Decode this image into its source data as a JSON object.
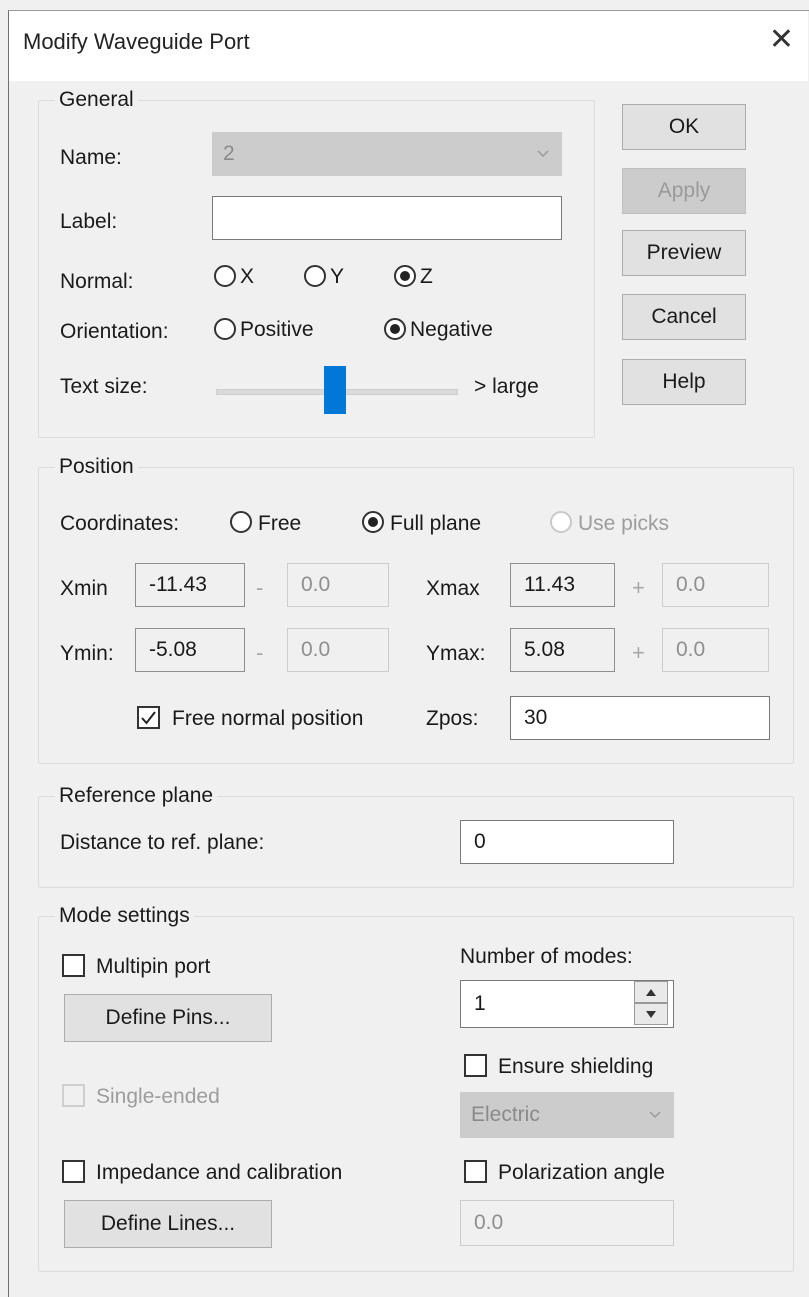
{
  "window": {
    "title": "Modify Waveguide Port",
    "close_glyph": "✕"
  },
  "general": {
    "legend": "General",
    "name_label": "Name:",
    "name_value": "2",
    "label_label": "Label:",
    "label_value": "",
    "normal_label": "Normal:",
    "normal_options": [
      "X",
      "Y",
      "Z"
    ],
    "normal_selected": "Z",
    "orientation_label": "Orientation:",
    "orientation_options": [
      "Positive",
      "Negative"
    ],
    "orientation_selected": "Negative",
    "text_size_label": "Text size:",
    "text_size_level": 0.5,
    "text_size_hint": "> large"
  },
  "buttons": {
    "ok": "OK",
    "apply": "Apply",
    "preview": "Preview",
    "cancel": "Cancel",
    "help": "Help"
  },
  "position": {
    "legend": "Position",
    "coordinates_label": "Coordinates:",
    "coordinates_options": [
      "Free",
      "Full plane",
      "Use picks"
    ],
    "coordinates_selected": "Full plane",
    "xmin_label": "Xmin",
    "xmin_value": "-11.43",
    "xmin_minus": "-",
    "xmin_offset": "0.0",
    "xmax_label": "Xmax",
    "xmax_value": "11.43",
    "xmax_plus": "+",
    "xmax_offset": "0.0",
    "ymin_label": "Ymin:",
    "ymin_value": "-5.08",
    "ymin_minus": "-",
    "ymin_offset": "0.0",
    "ymax_label": "Ymax:",
    "ymax_value": "5.08",
    "ymax_plus": "+",
    "ymax_offset": "0.0",
    "free_normal_label": "Free normal position",
    "free_normal_checked": true,
    "zpos_label": "Zpos:",
    "zpos_value": "30"
  },
  "reference_plane": {
    "legend": "Reference plane",
    "distance_label": "Distance to ref. plane:",
    "distance_value": "0"
  },
  "mode_settings": {
    "legend": "Mode settings",
    "multipin_label": "Multipin port",
    "define_pins_button": "Define Pins...",
    "single_ended_label": "Single-ended",
    "impedance_label": "Impedance and calibration",
    "define_lines_button": "Define Lines...",
    "number_of_modes_label": "Number of modes:",
    "number_of_modes_value": "1",
    "ensure_shielding_label": "Ensure shielding",
    "shielding_type_value": "Electric",
    "polarization_label": "Polarization angle",
    "polarization_value": "0.0"
  },
  "icons": {
    "close": "close-icon",
    "chevron": "chevron-down-icon",
    "check": "check-icon",
    "spin_up": "spin-up-icon",
    "spin_down": "spin-down-icon"
  }
}
